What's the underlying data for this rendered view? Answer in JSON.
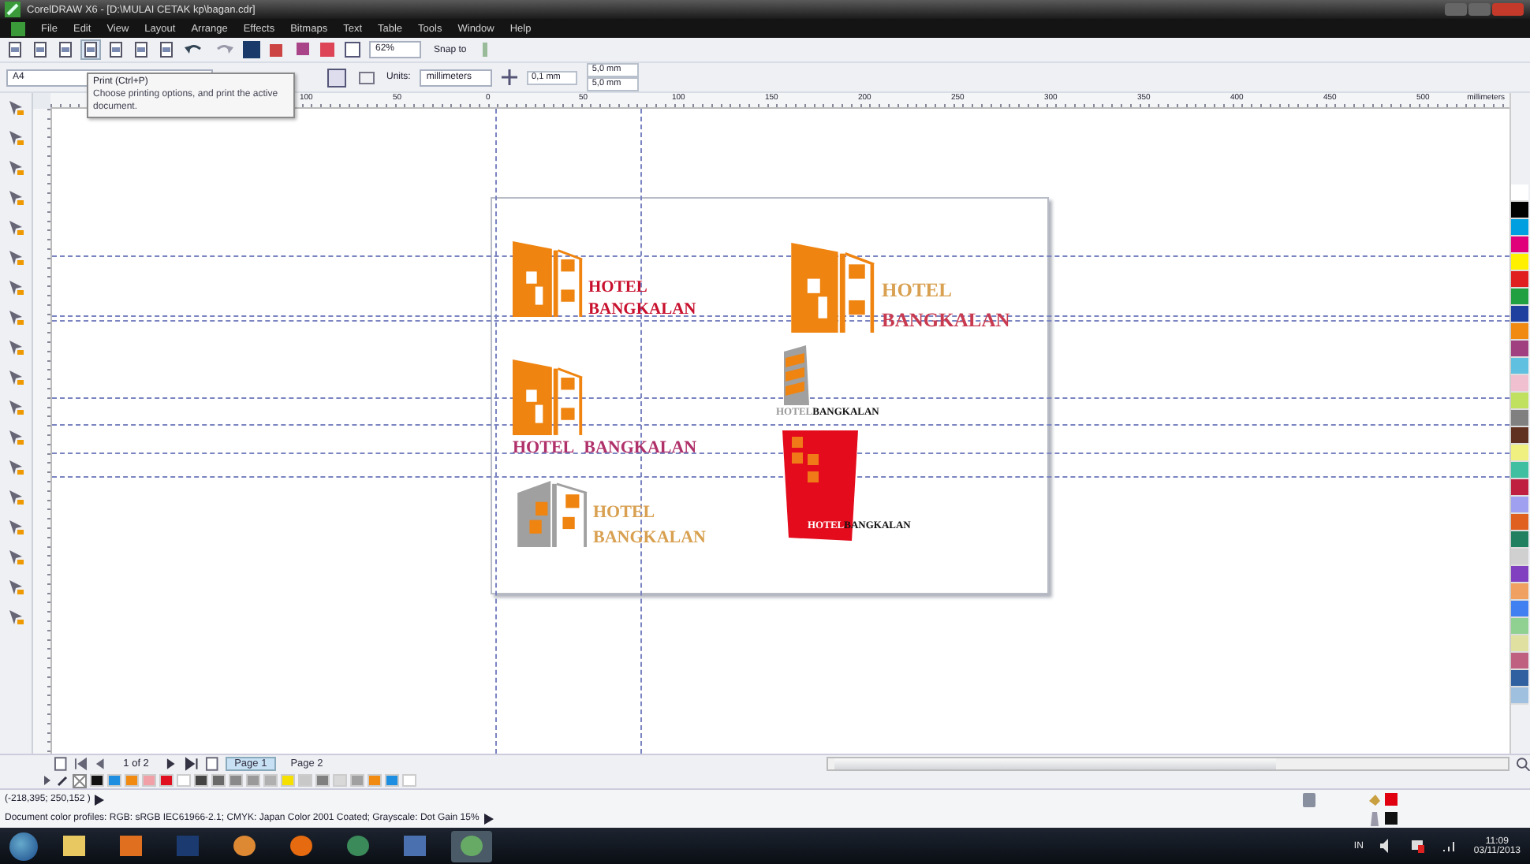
{
  "window": {
    "title": "CorelDRAW X6 - [D:\\MULAI CETAK kp\\bagan.cdr]"
  },
  "menu": [
    "File",
    "Edit",
    "View",
    "Layout",
    "Arrange",
    "Effects",
    "Bitmaps",
    "Text",
    "Table",
    "Tools",
    "Window",
    "Help"
  ],
  "toolbar": {
    "zoom": "62%",
    "snap": "Snap to"
  },
  "property_bar": {
    "page_size": "A4",
    "units_label": "Units:",
    "units": "millimeters",
    "nudge": "0,1 mm",
    "duplicate_x": "5,0 mm",
    "duplicate_y": "5,0 mm"
  },
  "tooltip": {
    "title": "Print (Ctrl+P)",
    "text": "Choose printing options, and print the active document."
  },
  "ruler": {
    "labels": [
      "100",
      "50",
      "0",
      "50",
      "100",
      "150",
      "200",
      "250",
      "300",
      "350",
      "400",
      "450",
      "500"
    ],
    "unit": "millimeters"
  },
  "logos": [
    {
      "kind": "side",
      "hotel": "HOTEL",
      "name": "BANGKALAN"
    },
    {
      "kind": "side-large",
      "hotel": "HOTEL",
      "name": "BANGKALAN"
    },
    {
      "kind": "below",
      "hotel": "HOTEL",
      "name": "BANGKALAN"
    },
    {
      "kind": "tower",
      "hotel": "HOTEL",
      "name": "BANGKALAN"
    },
    {
      "kind": "gray",
      "hotel": "HOTEL",
      "name": "BANGKALAN"
    },
    {
      "kind": "block",
      "hotel": "HOTEL",
      "name": "BANGKALAN"
    }
  ],
  "page_nav": {
    "position": "1 of 2",
    "tabs": [
      {
        "label": "Page 1",
        "selected": true
      },
      {
        "label": "Page 2",
        "selected": false
      }
    ]
  },
  "document_palette": [
    {
      "color": "#111111"
    },
    {
      "color": "#1e8fe0"
    },
    {
      "color": "#f08a10"
    },
    {
      "color": "#f2a0a8"
    },
    {
      "color": "#e01020"
    },
    {
      "color": "#ffffff"
    },
    {
      "color": "#444444"
    },
    {
      "color": "#6a6a6a"
    },
    {
      "color": "#8a8a8a"
    },
    {
      "color": "#9a9a9a"
    },
    {
      "color": "#b0b0b0"
    },
    {
      "color": "#f5e000"
    },
    {
      "color": "#c8c8c8"
    },
    {
      "color": "#808080"
    },
    {
      "color": "#d8d8d8"
    },
    {
      "color": "#a0a0a0"
    },
    {
      "color": "#f08a10"
    },
    {
      "color": "#1e8fe0"
    },
    {
      "color": "#ffffff"
    }
  ],
  "palette": [
    {
      "color": "#ffffff"
    },
    {
      "color": "#000000"
    },
    {
      "color": "#00a0e0"
    },
    {
      "color": "#e0007a"
    },
    {
      "color": "#fff000"
    },
    {
      "color": "#e02020"
    },
    {
      "color": "#20a040"
    },
    {
      "color": "#2040a0"
    },
    {
      "color": "#f08a10"
    },
    {
      "color": "#a04080"
    },
    {
      "color": "#60c0e0"
    },
    {
      "color": "#f0c0d0"
    },
    {
      "color": "#c0e060"
    },
    {
      "color": "#808080"
    },
    {
      "color": "#603020"
    },
    {
      "color": "#f0f080"
    },
    {
      "color": "#40c0a0"
    },
    {
      "color": "#c02040"
    },
    {
      "color": "#a0a0f0"
    },
    {
      "color": "#e06020"
    },
    {
      "color": "#208060"
    },
    {
      "color": "#d0d0d0"
    },
    {
      "color": "#8040c0"
    },
    {
      "color": "#f0a060"
    },
    {
      "color": "#4080f0"
    },
    {
      "color": "#90d090"
    },
    {
      "color": "#e0e0a0"
    },
    {
      "color": "#c06080"
    },
    {
      "color": "#3060a0"
    },
    {
      "color": "#a0c0e0"
    }
  ],
  "status": {
    "coordinates": "(-218,395; 250,152 )",
    "profiles": "Document color profiles: RGB: sRGB IEC61966-2.1; CMYK: Japan Color 2001 Coated; Grayscale: Dot Gain 15%"
  },
  "taskbar": {
    "language": "IN",
    "time": "11:09",
    "date": "03/11/2013"
  }
}
